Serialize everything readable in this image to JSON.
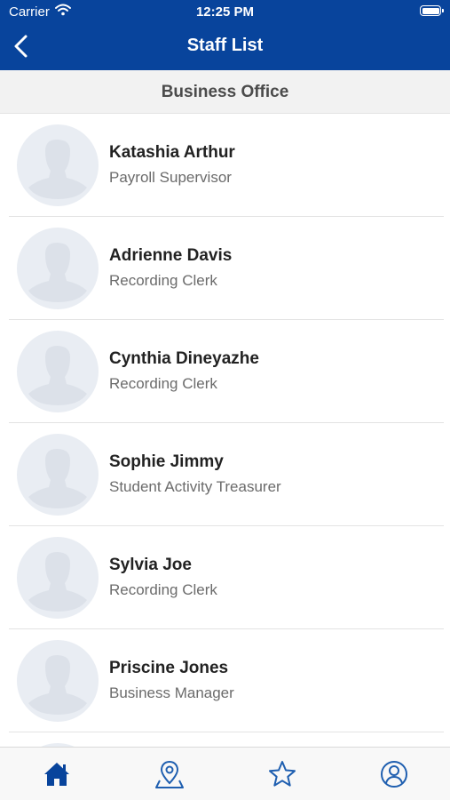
{
  "status_bar": {
    "carrier": "Carrier",
    "time": "12:25 PM"
  },
  "nav": {
    "back_icon": "chevron-left-icon",
    "title": "Staff List"
  },
  "section": {
    "title": "Business Office"
  },
  "staff": [
    {
      "name": "Katashia Arthur",
      "title": "Payroll Supervisor"
    },
    {
      "name": "Adrienne Davis",
      "title": "Recording Clerk"
    },
    {
      "name": "Cynthia Dineyazhe",
      "title": "Recording Clerk"
    },
    {
      "name": "Sophie Jimmy",
      "title": "Student Activity Treasurer"
    },
    {
      "name": "Sylvia Joe",
      "title": "Recording Clerk"
    },
    {
      "name": "Priscine Jones",
      "title": "Business Manager"
    }
  ],
  "tab_bar": [
    {
      "icon": "home-icon",
      "selected": true
    },
    {
      "icon": "location-pin-icon",
      "selected": false
    },
    {
      "icon": "star-icon",
      "selected": false
    },
    {
      "icon": "user-profile-icon",
      "selected": false
    }
  ],
  "colors": {
    "brand": "#08449c",
    "tab_active": "#08449c",
    "tab_inactive": "#1f5fb0"
  }
}
